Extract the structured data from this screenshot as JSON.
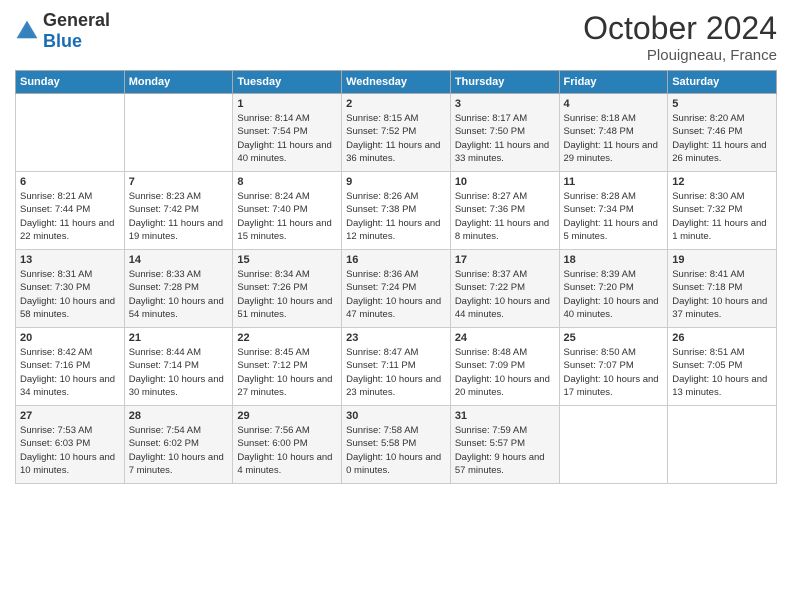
{
  "header": {
    "logo_general": "General",
    "logo_blue": "Blue",
    "month": "October 2024",
    "location": "Plouigneau, France"
  },
  "weekdays": [
    "Sunday",
    "Monday",
    "Tuesday",
    "Wednesday",
    "Thursday",
    "Friday",
    "Saturday"
  ],
  "weeks": [
    [
      {
        "day": "",
        "sunrise": "",
        "sunset": "",
        "daylight": ""
      },
      {
        "day": "",
        "sunrise": "",
        "sunset": "",
        "daylight": ""
      },
      {
        "day": "1",
        "sunrise": "Sunrise: 8:14 AM",
        "sunset": "Sunset: 7:54 PM",
        "daylight": "Daylight: 11 hours and 40 minutes."
      },
      {
        "day": "2",
        "sunrise": "Sunrise: 8:15 AM",
        "sunset": "Sunset: 7:52 PM",
        "daylight": "Daylight: 11 hours and 36 minutes."
      },
      {
        "day": "3",
        "sunrise": "Sunrise: 8:17 AM",
        "sunset": "Sunset: 7:50 PM",
        "daylight": "Daylight: 11 hours and 33 minutes."
      },
      {
        "day": "4",
        "sunrise": "Sunrise: 8:18 AM",
        "sunset": "Sunset: 7:48 PM",
        "daylight": "Daylight: 11 hours and 29 minutes."
      },
      {
        "day": "5",
        "sunrise": "Sunrise: 8:20 AM",
        "sunset": "Sunset: 7:46 PM",
        "daylight": "Daylight: 11 hours and 26 minutes."
      }
    ],
    [
      {
        "day": "6",
        "sunrise": "Sunrise: 8:21 AM",
        "sunset": "Sunset: 7:44 PM",
        "daylight": "Daylight: 11 hours and 22 minutes."
      },
      {
        "day": "7",
        "sunrise": "Sunrise: 8:23 AM",
        "sunset": "Sunset: 7:42 PM",
        "daylight": "Daylight: 11 hours and 19 minutes."
      },
      {
        "day": "8",
        "sunrise": "Sunrise: 8:24 AM",
        "sunset": "Sunset: 7:40 PM",
        "daylight": "Daylight: 11 hours and 15 minutes."
      },
      {
        "day": "9",
        "sunrise": "Sunrise: 8:26 AM",
        "sunset": "Sunset: 7:38 PM",
        "daylight": "Daylight: 11 hours and 12 minutes."
      },
      {
        "day": "10",
        "sunrise": "Sunrise: 8:27 AM",
        "sunset": "Sunset: 7:36 PM",
        "daylight": "Daylight: 11 hours and 8 minutes."
      },
      {
        "day": "11",
        "sunrise": "Sunrise: 8:28 AM",
        "sunset": "Sunset: 7:34 PM",
        "daylight": "Daylight: 11 hours and 5 minutes."
      },
      {
        "day": "12",
        "sunrise": "Sunrise: 8:30 AM",
        "sunset": "Sunset: 7:32 PM",
        "daylight": "Daylight: 11 hours and 1 minute."
      }
    ],
    [
      {
        "day": "13",
        "sunrise": "Sunrise: 8:31 AM",
        "sunset": "Sunset: 7:30 PM",
        "daylight": "Daylight: 10 hours and 58 minutes."
      },
      {
        "day": "14",
        "sunrise": "Sunrise: 8:33 AM",
        "sunset": "Sunset: 7:28 PM",
        "daylight": "Daylight: 10 hours and 54 minutes."
      },
      {
        "day": "15",
        "sunrise": "Sunrise: 8:34 AM",
        "sunset": "Sunset: 7:26 PM",
        "daylight": "Daylight: 10 hours and 51 minutes."
      },
      {
        "day": "16",
        "sunrise": "Sunrise: 8:36 AM",
        "sunset": "Sunset: 7:24 PM",
        "daylight": "Daylight: 10 hours and 47 minutes."
      },
      {
        "day": "17",
        "sunrise": "Sunrise: 8:37 AM",
        "sunset": "Sunset: 7:22 PM",
        "daylight": "Daylight: 10 hours and 44 minutes."
      },
      {
        "day": "18",
        "sunrise": "Sunrise: 8:39 AM",
        "sunset": "Sunset: 7:20 PM",
        "daylight": "Daylight: 10 hours and 40 minutes."
      },
      {
        "day": "19",
        "sunrise": "Sunrise: 8:41 AM",
        "sunset": "Sunset: 7:18 PM",
        "daylight": "Daylight: 10 hours and 37 minutes."
      }
    ],
    [
      {
        "day": "20",
        "sunrise": "Sunrise: 8:42 AM",
        "sunset": "Sunset: 7:16 PM",
        "daylight": "Daylight: 10 hours and 34 minutes."
      },
      {
        "day": "21",
        "sunrise": "Sunrise: 8:44 AM",
        "sunset": "Sunset: 7:14 PM",
        "daylight": "Daylight: 10 hours and 30 minutes."
      },
      {
        "day": "22",
        "sunrise": "Sunrise: 8:45 AM",
        "sunset": "Sunset: 7:12 PM",
        "daylight": "Daylight: 10 hours and 27 minutes."
      },
      {
        "day": "23",
        "sunrise": "Sunrise: 8:47 AM",
        "sunset": "Sunset: 7:11 PM",
        "daylight": "Daylight: 10 hours and 23 minutes."
      },
      {
        "day": "24",
        "sunrise": "Sunrise: 8:48 AM",
        "sunset": "Sunset: 7:09 PM",
        "daylight": "Daylight: 10 hours and 20 minutes."
      },
      {
        "day": "25",
        "sunrise": "Sunrise: 8:50 AM",
        "sunset": "Sunset: 7:07 PM",
        "daylight": "Daylight: 10 hours and 17 minutes."
      },
      {
        "day": "26",
        "sunrise": "Sunrise: 8:51 AM",
        "sunset": "Sunset: 7:05 PM",
        "daylight": "Daylight: 10 hours and 13 minutes."
      }
    ],
    [
      {
        "day": "27",
        "sunrise": "Sunrise: 7:53 AM",
        "sunset": "Sunset: 6:03 PM",
        "daylight": "Daylight: 10 hours and 10 minutes."
      },
      {
        "day": "28",
        "sunrise": "Sunrise: 7:54 AM",
        "sunset": "Sunset: 6:02 PM",
        "daylight": "Daylight: 10 hours and 7 minutes."
      },
      {
        "day": "29",
        "sunrise": "Sunrise: 7:56 AM",
        "sunset": "Sunset: 6:00 PM",
        "daylight": "Daylight: 10 hours and 4 minutes."
      },
      {
        "day": "30",
        "sunrise": "Sunrise: 7:58 AM",
        "sunset": "Sunset: 5:58 PM",
        "daylight": "Daylight: 10 hours and 0 minutes."
      },
      {
        "day": "31",
        "sunrise": "Sunrise: 7:59 AM",
        "sunset": "Sunset: 5:57 PM",
        "daylight": "Daylight: 9 hours and 57 minutes."
      },
      {
        "day": "",
        "sunrise": "",
        "sunset": "",
        "daylight": ""
      },
      {
        "day": "",
        "sunrise": "",
        "sunset": "",
        "daylight": ""
      }
    ]
  ]
}
